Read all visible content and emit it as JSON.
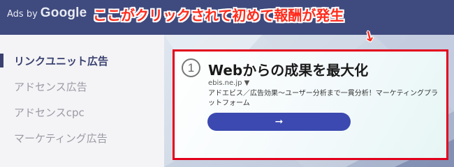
{
  "header": {
    "ads_by_prefix": "Ads by",
    "ads_by_brand": "Google"
  },
  "annotation": {
    "text": "ここがクリックされて初めて報酬が発生",
    "arrow": "↘",
    "color": "#ff2b1c"
  },
  "menu": {
    "items": [
      {
        "label": "リンクユニット広告",
        "active": true
      },
      {
        "label": "アドセンス広告",
        "active": false
      },
      {
        "label": "アドセンスcpc",
        "active": false
      },
      {
        "label": "マーケティング広告",
        "active": false
      }
    ]
  },
  "ad": {
    "number": "1",
    "title": "Webからの成果を最大化",
    "url": "ebis.ne.jp ▼",
    "description": "アドエビス／広告効果〜ユーザー分析まで一貫分析！マーケティングプラットフォーム",
    "cta_icon": "arrow-right-icon",
    "cta_arrow": "➞",
    "highlight_color": "#e3001b",
    "button_color": "#3b49b0"
  },
  "colors": {
    "header_bg": "#3f4a7e",
    "menu_active": "#3a4170"
  }
}
